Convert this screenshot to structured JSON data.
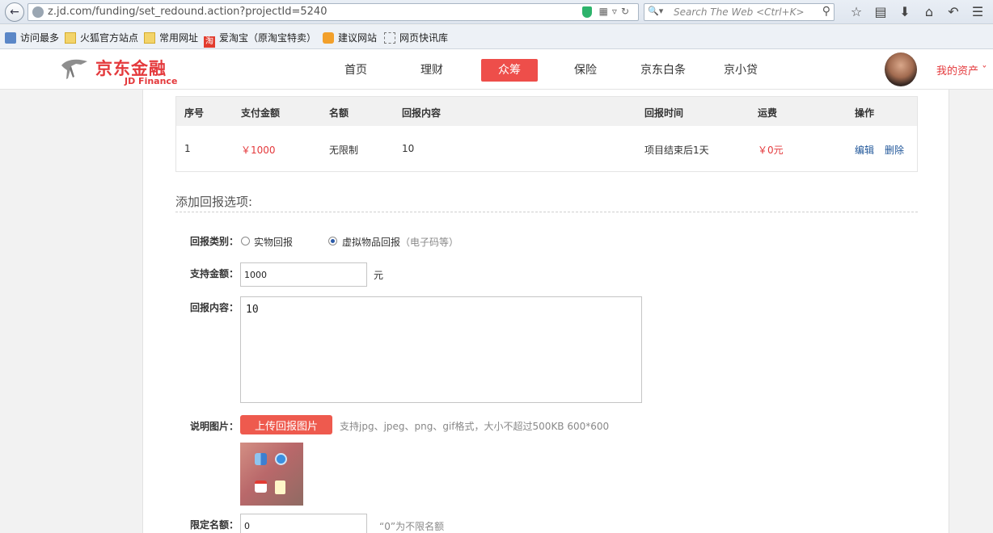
{
  "browser": {
    "url": "z.jd.com/funding/set_redound.action?projectId=5240",
    "search_placeholder": "Search The Web <Ctrl+K>",
    "bookmarks": [
      "访问最多",
      "火狐官方站点",
      "常用网址",
      "爱淘宝（原淘宝特卖）",
      "建议网站",
      "网页快讯库"
    ],
    "taobao_badge": "淘"
  },
  "site": {
    "logo_cn": "京东金融",
    "logo_en": "JD Finance",
    "nav": [
      "首页",
      "理财",
      "众筹",
      "保险",
      "京东白条",
      "京小贷"
    ],
    "active_nav": "众筹",
    "my_assets": "我的资产"
  },
  "table": {
    "headers": [
      "序号",
      "支付金额",
      "名额",
      "回报内容",
      "回报时间",
      "运费",
      "操作"
    ],
    "row": {
      "index": "1",
      "amount": "￥1000",
      "quota": "无限制",
      "content": "10",
      "time": "项目结束后1天",
      "shipping": "￥0元",
      "edit": "编辑",
      "delete": "删除"
    }
  },
  "form": {
    "title": "添加回报选项:",
    "type_label": "回报类别：",
    "type_physical": "实物回报",
    "type_virtual": "虚拟物品回报",
    "type_virtual_note": "（电子码等）",
    "amount_label": "支持金额：",
    "amount_value": "1000",
    "amount_unit": "元",
    "content_label": "回报内容：",
    "content_value": "10",
    "image_label": "说明图片：",
    "upload_button": "上传回报图片",
    "upload_hint": "支持jpg、jpeg、png、gif格式，大小不超过500KB 600*600",
    "limit_label": "限定名额：",
    "limit_value": "0",
    "limit_hint": "“0”为不限名额"
  },
  "colors": {
    "accent": "#e4393c",
    "link": "#21579a"
  }
}
